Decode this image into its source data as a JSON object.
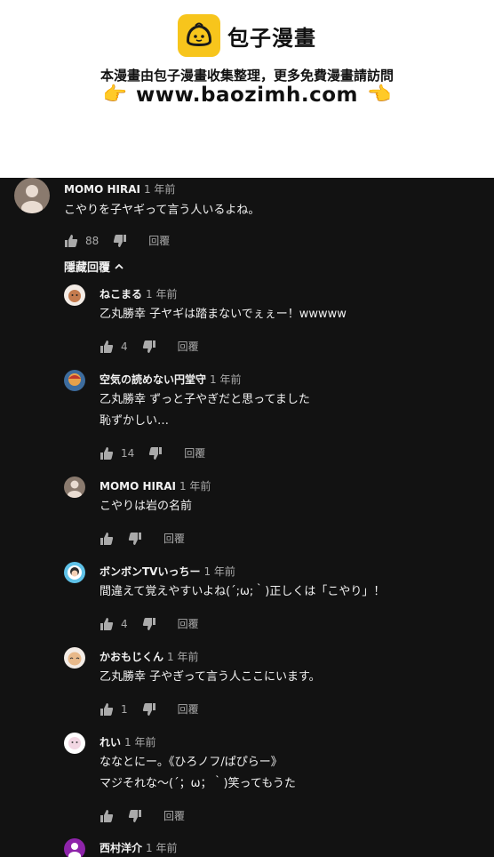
{
  "banner": {
    "logo_text": "包子漫畫",
    "subtitle": "本漫畫由包子漫畫收集整理，更多免費漫畫請訪問",
    "url": "www.baozimh.com",
    "hand_left": "👉",
    "hand_right": "👈"
  },
  "reply_label": "回覆",
  "hide_replies_label": "隱藏回覆",
  "comments": [
    {
      "author": "MOMO HIRAI",
      "time": "1 年前",
      "lines": [
        "こやりを子ヤギって言う人いるよね。"
      ],
      "likes": "88"
    },
    {
      "author": "ねこまる",
      "time": "1 年前",
      "lines": [
        "乙丸勝幸 子ヤギは踏まないでぇぇー！wwwww"
      ],
      "likes": "4"
    },
    {
      "author": "空気の読めない円堂守",
      "time": "1 年前",
      "lines": [
        "乙丸勝幸 ずっと子やぎだと思ってました",
        "恥ずかしい…"
      ],
      "likes": "14"
    },
    {
      "author": "MOMO HIRAI",
      "time": "1 年前",
      "lines": [
        "こやりは岩の名前"
      ],
      "likes": ""
    },
    {
      "author": "ボンボンTVいっちー",
      "time": "1 年前",
      "lines": [
        "間違えて覚えやすいよね(´;ω;｀)正しくは「こやり」！"
      ],
      "likes": "4"
    },
    {
      "author": "かおもじくん",
      "time": "1 年前",
      "lines": [
        "乙丸勝幸 子やぎって言う人ここにいます。"
      ],
      "likes": "1"
    },
    {
      "author": "れい",
      "time": "1 年前",
      "lines": [
        "ななとにー。《ひろノフ/ぱぴらー》",
        "マジそれな～(´；ω；｀)笑ってもうた"
      ],
      "likes": ""
    },
    {
      "author": "西村洋介",
      "time": "1 年前",
      "lines": [],
      "likes": ""
    }
  ],
  "colors": {
    "background": "#121212",
    "text": "#f1f1f1",
    "secondary": "#aaaaaa",
    "logo_yellow": "#f7c51c"
  },
  "icons": [
    "thumb-up-icon",
    "thumb-down-icon",
    "chevron-up-icon",
    "logo-bun-icon"
  ]
}
